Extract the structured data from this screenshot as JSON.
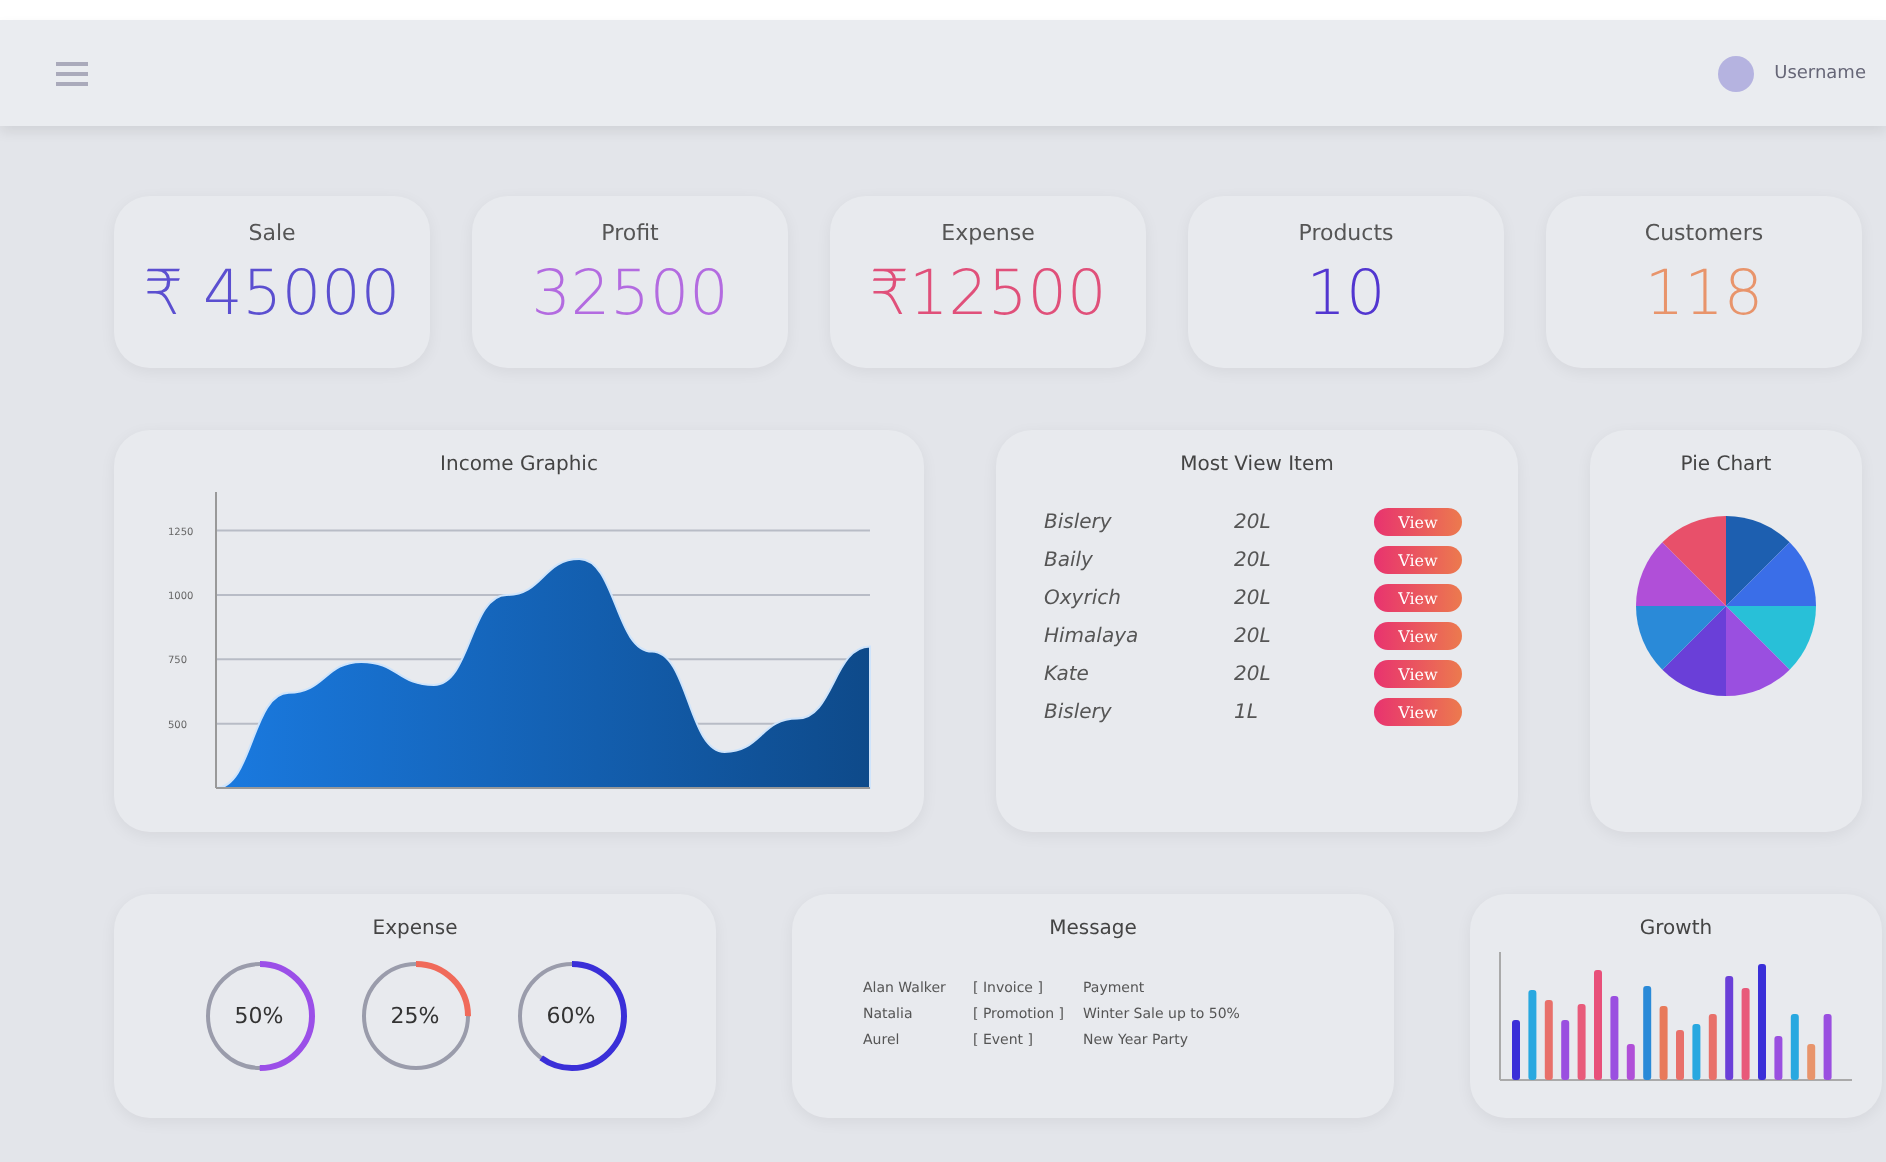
{
  "top_bar": {
    "username": "Username"
  },
  "stats": [
    {
      "label": "Sale",
      "value": "₹ 45000",
      "color": "#5b4fd0"
    },
    {
      "label": "Profit",
      "value": "32500",
      "color": "#b36be0"
    },
    {
      "label": "Expense",
      "value": "₹12500",
      "color": "#e0507a"
    },
    {
      "label": "Products",
      "value": "10",
      "color": "#5236d0"
    },
    {
      "label": "Customers",
      "value": "118",
      "color": "#e8946b"
    }
  ],
  "income": {
    "title": "Income Graphic",
    "chart_data": {
      "type": "area",
      "grid": true,
      "values": [
        250,
        620,
        740,
        650,
        1000,
        1140,
        780,
        390,
        520,
        800
      ],
      "ylim": [
        250,
        1400
      ],
      "yticks": [
        500,
        750,
        1000,
        1250
      ]
    }
  },
  "most_viewed": {
    "title": "Most View Item",
    "rows": [
      {
        "name": "Bislery",
        "size": "20L",
        "action": "View"
      },
      {
        "name": "Baily",
        "size": "20L",
        "action": "View"
      },
      {
        "name": "Oxyrich",
        "size": "20L",
        "action": "View"
      },
      {
        "name": "Himalaya",
        "size": "20L",
        "action": "View"
      },
      {
        "name": "Kate",
        "size": "20L",
        "action": "View"
      },
      {
        "name": "Bislery",
        "size": "1L",
        "action": "View"
      }
    ]
  },
  "pie": {
    "title": "Pie Chart"
  },
  "expense": {
    "title": "Expense",
    "rings": [
      {
        "label": "50%",
        "color": "#9b4fe8"
      },
      {
        "label": "25%",
        "color": "#f06a5a"
      },
      {
        "label": "60%",
        "color": "#3a2fd8"
      }
    ]
  },
  "message": {
    "title": "Message",
    "rows": [
      {
        "sender": "Alan Walker",
        "tag": "[ Invoice ]",
        "text": "Payment"
      },
      {
        "sender": "Natalia",
        "tag": "[ Promotion ]",
        "text": "Winter Sale up to 50%"
      },
      {
        "sender": "Aurel",
        "tag": "[ Event ]",
        "text": "New Year Party"
      }
    ]
  },
  "growth": {
    "title": "Growth"
  }
}
